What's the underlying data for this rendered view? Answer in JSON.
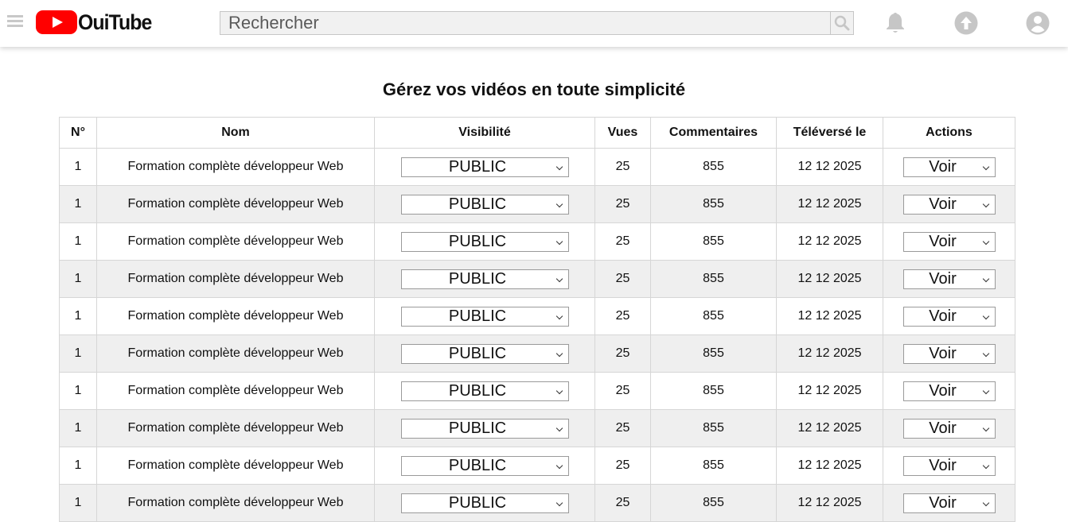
{
  "header": {
    "logo_text": "OuiTube",
    "search_placeholder": "Rechercher"
  },
  "page_title": "Gérez vos vidéos en toute simplicité",
  "table": {
    "columns": [
      "N°",
      "Nom",
      "Visibilité",
      "Vues",
      "Commentaires",
      "Téléversé le",
      "Actions"
    ],
    "rows": [
      {
        "num": "1",
        "name": "Formation complète développeur Web",
        "visibility": "PUBLIC",
        "views": "25",
        "comments": "855",
        "uploaded": "12 12 2025",
        "action": "Voir"
      },
      {
        "num": "1",
        "name": "Formation complète développeur Web",
        "visibility": "PUBLIC",
        "views": "25",
        "comments": "855",
        "uploaded": "12 12 2025",
        "action": "Voir"
      },
      {
        "num": "1",
        "name": "Formation complète développeur Web",
        "visibility": "PUBLIC",
        "views": "25",
        "comments": "855",
        "uploaded": "12 12 2025",
        "action": "Voir"
      },
      {
        "num": "1",
        "name": "Formation complète développeur Web",
        "visibility": "PUBLIC",
        "views": "25",
        "comments": "855",
        "uploaded": "12 12 2025",
        "action": "Voir"
      },
      {
        "num": "1",
        "name": "Formation complète développeur Web",
        "visibility": "PUBLIC",
        "views": "25",
        "comments": "855",
        "uploaded": "12 12 2025",
        "action": "Voir"
      },
      {
        "num": "1",
        "name": "Formation complète développeur Web",
        "visibility": "PUBLIC",
        "views": "25",
        "comments": "855",
        "uploaded": "12 12 2025",
        "action": "Voir"
      },
      {
        "num": "1",
        "name": "Formation complète développeur Web",
        "visibility": "PUBLIC",
        "views": "25",
        "comments": "855",
        "uploaded": "12 12 2025",
        "action": "Voir"
      },
      {
        "num": "1",
        "name": "Formation complète développeur Web",
        "visibility": "PUBLIC",
        "views": "25",
        "comments": "855",
        "uploaded": "12 12 2025",
        "action": "Voir"
      },
      {
        "num": "1",
        "name": "Formation complète développeur Web",
        "visibility": "PUBLIC",
        "views": "25",
        "comments": "855",
        "uploaded": "12 12 2025",
        "action": "Voir"
      },
      {
        "num": "1",
        "name": "Formation complète développeur Web",
        "visibility": "PUBLIC",
        "views": "25",
        "comments": "855",
        "uploaded": "12 12 2025",
        "action": "Voir"
      }
    ]
  },
  "icons": {
    "menu": "hamburger-menu-icon",
    "logo": "play-logo-icon",
    "search": "search-icon",
    "notifications": "bell-icon",
    "upload": "upload-icon",
    "account": "account-icon"
  },
  "colors": {
    "brand_red": "#ff0000",
    "alt_row": "#efefef",
    "icon_gray": "#c6c6c6"
  }
}
